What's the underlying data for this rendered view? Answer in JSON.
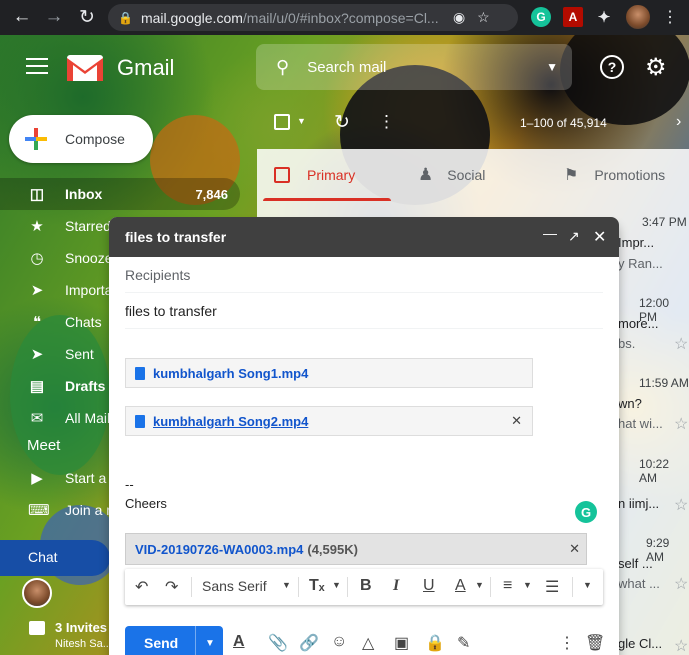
{
  "browser": {
    "url_host": "mail.google.com",
    "url_path": "/mail/u/0/#inbox?compose=Cl..."
  },
  "header": {
    "app_name": "Gmail",
    "search_placeholder": "Search mail"
  },
  "compose_button": {
    "label": "Compose"
  },
  "sidebar": {
    "items": [
      {
        "label": "Inbox",
        "count": "7,846",
        "icon": "inbox-icon",
        "active": true
      },
      {
        "label": "Starred",
        "icon": "star-icon"
      },
      {
        "label": "Snoozed",
        "icon": "clock-icon"
      },
      {
        "label": "Important",
        "icon": "label-important-icon"
      },
      {
        "label": "Chats",
        "icon": "chat-bubble-icon"
      },
      {
        "label": "Sent",
        "icon": "send-icon"
      },
      {
        "label": "Drafts",
        "icon": "draft-icon",
        "bold": true
      },
      {
        "label": "All Mail",
        "icon": "mail-icon"
      }
    ],
    "meet_heading": "Meet",
    "meet_items": [
      {
        "label": "Start a meeting",
        "icon": "videocam-icon"
      },
      {
        "label": "Join a meeting",
        "icon": "keyboard-icon"
      }
    ],
    "chat_label": "Chat",
    "invites_label": "3 Invites",
    "invites_sub": "Nitesh Sa..."
  },
  "toolbar": {
    "range": "1–100 of 45,914"
  },
  "tabs": [
    {
      "label": "Primary",
      "icon": "inbox-tab-icon"
    },
    {
      "label": "Social",
      "icon": "people-icon"
    },
    {
      "label": "Promotions",
      "icon": "tag-icon"
    }
  ],
  "inbox_rows": [
    {
      "time": "3:47 PM",
      "line1": "Impr...",
      "line2": "y Ran..."
    },
    {
      "time": "12:00 PM",
      "line1": "more...",
      "line2": "bs."
    },
    {
      "time": "11:59 AM",
      "line1": "wn?",
      "line2": "hat wi..."
    },
    {
      "time": "10:22 AM",
      "line1": "n iimj...",
      "line2": ""
    },
    {
      "time": "9:29 AM",
      "line1": "self ...",
      "line2": "what ..."
    },
    {
      "time": "",
      "line1": "gle Cl...",
      "line2": ""
    }
  ],
  "compose_window": {
    "title": "files to transfer",
    "recipients_placeholder": "Recipients",
    "subject": "files to transfer",
    "attachments": [
      {
        "name": "kumbhalgarh Song1.mp4",
        "underline": false,
        "removable": false
      },
      {
        "name": "kumbhalgarh Song2.mp4",
        "underline": true,
        "removable": true
      }
    ],
    "signature_dash": "--",
    "signature_text": "Cheers",
    "video_attachment": {
      "name": "VID-20190726-WA0003.mp4",
      "size": "(4,595K)"
    },
    "font_name": "Sans Serif",
    "send_label": "Send"
  },
  "colors": {
    "accent_red": "#d93025",
    "send_blue": "#1a73e8",
    "compose_header": "#404040",
    "chat_blue": "#174ea6"
  }
}
